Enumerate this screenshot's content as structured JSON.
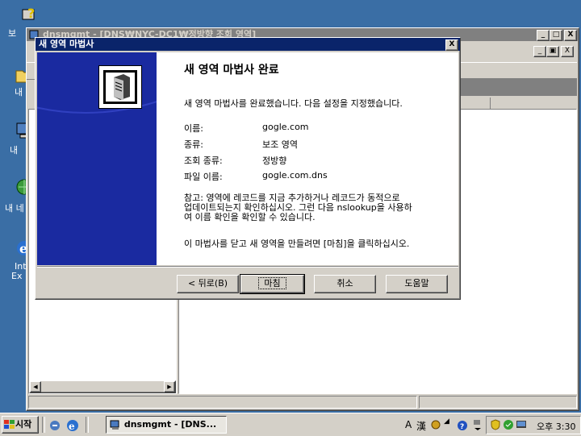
{
  "desktop": {
    "icons": [
      {
        "label": "보"
      },
      {
        "label": "내"
      },
      {
        "label": "내"
      },
      {
        "label": "내 네"
      },
      {
        "label": "Int"
      },
      {
        "label": "Ex"
      }
    ]
  },
  "mmc": {
    "title": "dnsmgmt - [DNS₩NYC-DC1₩정방향 조회 영역]",
    "minimize": "_",
    "maximize": "□",
    "close": "X",
    "inner_minimize": "_",
    "inner_restore": "▣",
    "inner_close": "X"
  },
  "wizard": {
    "title": "새 영역 마법사",
    "close": "X",
    "heading": "새 영역 마법사 완료",
    "intro": "새 영역 마법사를 완료했습니다. 다음 설정을 지정했습니다.",
    "fields": [
      {
        "label": "이름:",
        "value": "gogle.com"
      },
      {
        "label": "종류:",
        "value": "보조 영역"
      },
      {
        "label": "조회 종류:",
        "value": "정방향"
      },
      {
        "label": "파일 이름:",
        "value": "gogle.com.dns"
      }
    ],
    "note_line1": "참고: 영역에 레코드를 지금 추가하거나 레코드가 동적으로",
    "note_line2": "업데이트되는지 확인하십시오. 그런 다음 nslookup을 사용하",
    "note_line3": "여 이름 확인을 확인할 수 있습니다.",
    "closing": "이 마법사를 닫고 새 영역을 만들려면 [마침]을 클릭하십시오.",
    "buttons": {
      "back": "< 뒤로(B)",
      "finish": "마침",
      "cancel": "취소",
      "help": "도움말"
    }
  },
  "taskbar": {
    "start": "시작",
    "task": "dnsmgmt - [DNS...",
    "lang_a": "A",
    "lang_han": "漢",
    "clock": "오후 3:30"
  }
}
